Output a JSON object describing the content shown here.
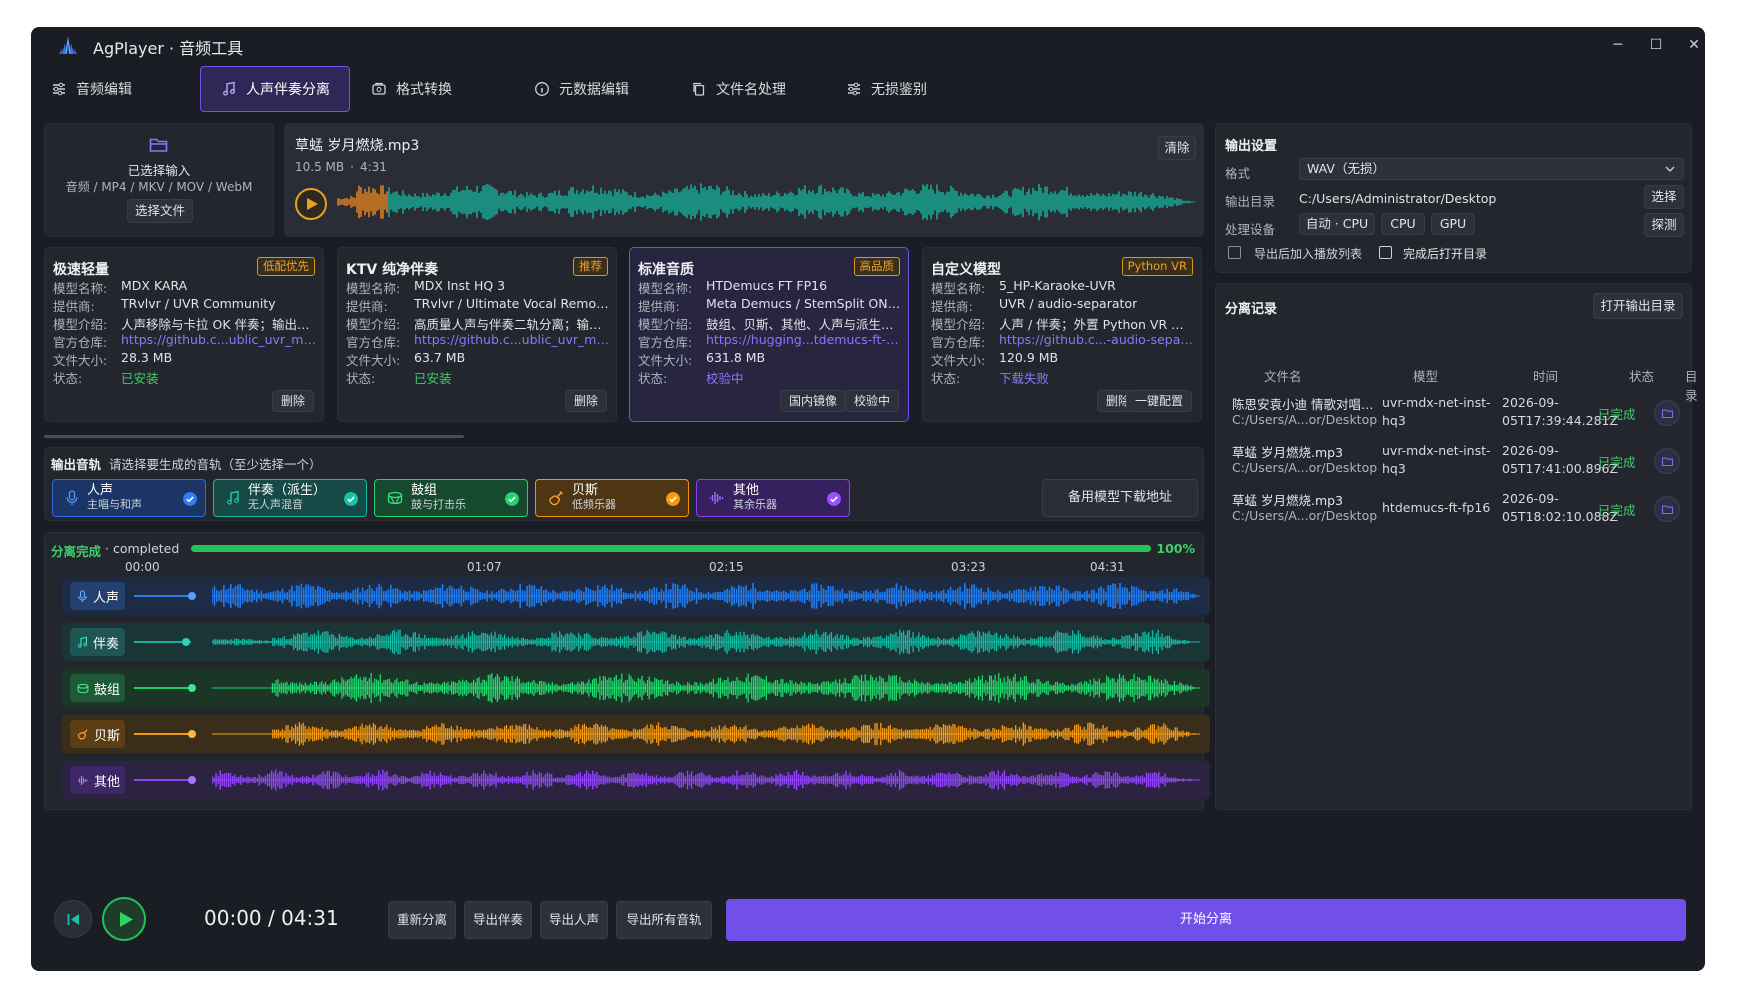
{
  "window": {
    "title": "AgPlayer · 音频工具",
    "controls": [
      "─",
      "☐",
      "✕"
    ]
  },
  "tabs": [
    {
      "label": "音频编辑",
      "icon": "sliders-icon",
      "active": false
    },
    {
      "label": "人声伴奏分离",
      "icon": "music-note-icon",
      "active": true
    },
    {
      "label": "格式转换",
      "icon": "convert-icon",
      "active": false
    },
    {
      "label": "元数据编辑",
      "icon": "info-icon",
      "active": false
    },
    {
      "label": "文件名处理",
      "icon": "copy-icon",
      "active": false
    },
    {
      "label": "无损鉴别",
      "icon": "sliders-icon",
      "active": false
    }
  ],
  "input": {
    "title": "已选择输入",
    "formats": "音频 / MP4 / MKV / MOV / WebM",
    "choose_button": "选择文件"
  },
  "file": {
    "name": "草蜢 岁月燃烧.mp3",
    "size": "10.5 MB",
    "duration": "4:31",
    "meta_sep": "·",
    "clear_button": "清除",
    "progress": 0.06
  },
  "output_settings": {
    "title": "输出设置",
    "format_label": "格式",
    "format_value": "WAV（无损）",
    "dir_label": "输出目录",
    "dir_value": "C:/Users/Administrator/Desktop",
    "dir_button": "选择",
    "device_label": "处理设备",
    "devices": [
      "自动 · CPU",
      "CPU",
      "GPU"
    ],
    "probe_button": "探测",
    "opt1": "导出后加入播放列表",
    "opt2": "完成后打开目录"
  },
  "model_keys": {
    "name": "模型名称:",
    "provider": "提供商:",
    "desc": "模型介绍:",
    "repo": "官方仓库:",
    "size": "文件大小:",
    "status": "状态:"
  },
  "models": [
    {
      "title": "极速轻量",
      "badge": "低配优先",
      "name": "MDX KARA",
      "provider": "TRvlvr / UVR Community",
      "desc": "人声移除与卡拉 OK 伴奏；输出：...",
      "repo": "https://github.c...ublic_uvr_models",
      "size": "28.3 MB",
      "status": "已安装",
      "buttons": [
        "删除"
      ]
    },
    {
      "title": "KTV 纯净伴奏",
      "badge": "推荐",
      "name": "MDX Inst HQ 3",
      "provider": "TRvlvr / Ultimate Vocal Remover",
      "desc": "高质量人声与伴奏二轨分离；输出...",
      "repo": "https://github.c...ublic_uvr_models",
      "size": "63.7 MB",
      "status": "已安装",
      "buttons": [
        "删除"
      ]
    },
    {
      "title": "标准音质",
      "badge": "高品质",
      "name": "HTDemucs FT FP16",
      "provider": "Meta Demucs / StemSplit ONNX...",
      "desc": "鼓组、贝斯、其他、人声与派生伴...",
      "repo": "https://hugging...tdemucs-ft-onnx",
      "size": "631.8 MB",
      "status": "校验中",
      "buttons": [
        "国内镜像",
        "校验中"
      ]
    },
    {
      "title": "自定义模型",
      "badge": "Python VR",
      "name": "5_HP-Karaoke-UVR",
      "provider": "UVR / audio-separator",
      "desc": "人声 / 伴奏；外置 Python VR 推理...",
      "repo": "https://github.c...-audio-separator",
      "size": "120.9 MB",
      "status": "下载失败",
      "buttons": [
        "删除",
        "一键配置"
      ]
    }
  ],
  "tracks": {
    "label": "输出音轨",
    "hint": "请选择要生成的音轨（至少选择一个）",
    "items": [
      {
        "name": "人声",
        "sub": "主唱与和声",
        "color": "#1f6fe5",
        "bg": "#1a3566"
      },
      {
        "name": "伴奏（派生）",
        "sub": "无人声混音",
        "color": "#12b8a0",
        "bg": "#154a46"
      },
      {
        "name": "鼓组",
        "sub": "鼓与打击乐",
        "color": "#1fd36b",
        "bg": "#164a2e"
      },
      {
        "name": "贝斯",
        "sub": "低频乐器",
        "color": "#f3950d",
        "bg": "#4e3514"
      },
      {
        "name": "其他",
        "sub": "其余乐器",
        "color": "#8a3ff2",
        "bg": "#36215e"
      }
    ],
    "backup_button": "备用模型下载地址"
  },
  "result": {
    "status": "分离完成",
    "status_en": "· completed",
    "percent": "100%",
    "progress": 1.0,
    "ticks": [
      "00:00",
      "01:07",
      "02:15",
      "03:23",
      "04:31"
    ]
  },
  "lanes": [
    {
      "label": "人声",
      "color": "#1e7bf0",
      "bg": "#1d2b44"
    },
    {
      "label": "伴奏",
      "color": "#13bba4",
      "bg": "#1b3436"
    },
    {
      "label": "鼓组",
      "color": "#22d870",
      "bg": "#1b3526"
    },
    {
      "label": "贝斯",
      "color": "#f59a12",
      "bg": "#3a2d1a"
    },
    {
      "label": "其他",
      "color": "#8e45f5",
      "bg": "#2b2340"
    }
  ],
  "history": {
    "title": "分离记录",
    "open_button": "打开输出目录",
    "headers": [
      "文件名",
      "模型",
      "时间",
      "状态",
      "目录"
    ],
    "rows": [
      {
        "file": "陈思安袁小迪 情歌对唱....",
        "path": "C:/Users/A...or/Desktop",
        "model": "uvr-mdx-net-inst-hq3",
        "time": "2026-09-05T17:39:44.281Z",
        "status": "已完成"
      },
      {
        "file": "草蜢 岁月燃烧.mp3",
        "path": "C:/Users/A...or/Desktop",
        "model": "uvr-mdx-net-inst-hq3",
        "time": "2026-09-05T17:41:00.896Z",
        "status": "已完成"
      },
      {
        "file": "草蜢 岁月燃烧.mp3",
        "path": "C:/Users/A...or/Desktop",
        "model": "htdemucs-ft-fp16",
        "time": "2026-09-05T18:02:10.088Z",
        "status": "已完成"
      }
    ]
  },
  "transport": {
    "time": "00:00 / 04:31",
    "buttons": [
      "重新分离",
      "导出伴奏",
      "导出人声",
      "导出所有音轨"
    ],
    "start_button": "开始分离"
  },
  "colors": {
    "accent": "#7050e8",
    "success": "#3fcf6a",
    "teal": "#15b79f"
  }
}
